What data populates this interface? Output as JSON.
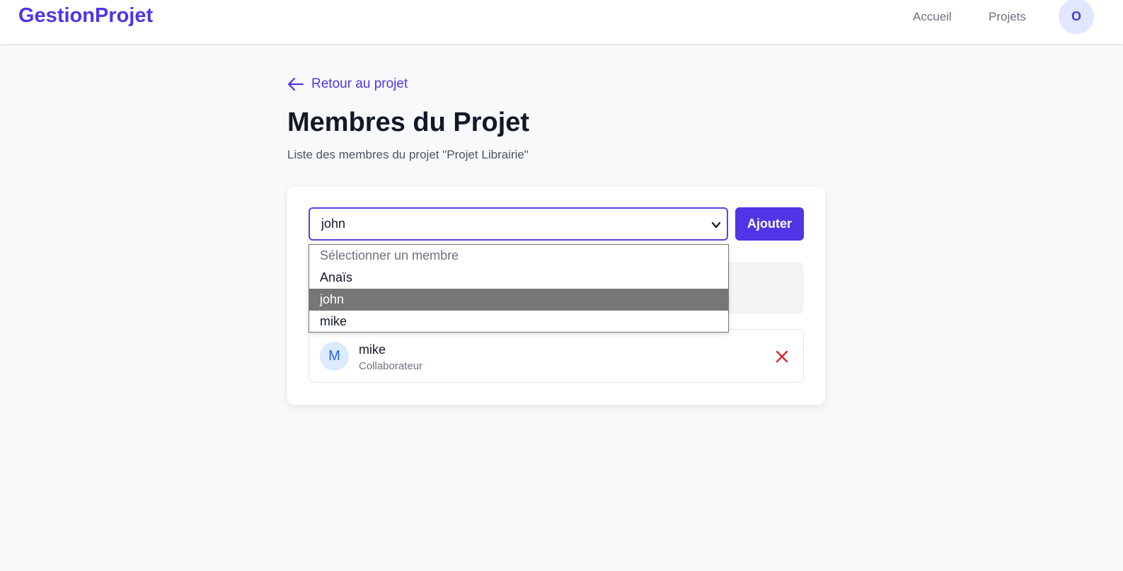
{
  "navbar": {
    "brand": "GestionProjet",
    "links": [
      {
        "label": "Accueil"
      },
      {
        "label": "Projets"
      }
    ],
    "user_initial": "O"
  },
  "back_link": {
    "label": "Retour au projet",
    "icon": "arrow-left-icon"
  },
  "page": {
    "title": "Membres du Projet",
    "subtitle": "Liste des membres du projet \"Projet Librairie\""
  },
  "add_member": {
    "selected_value": "john",
    "button_label": "Ajouter",
    "options": [
      {
        "label": "Sélectionner un membre",
        "placeholder": true
      },
      {
        "label": "Anaïs"
      },
      {
        "label": "john",
        "selected": true
      },
      {
        "label": "mike"
      }
    ]
  },
  "members": [
    {
      "initial": "M",
      "name": "mike",
      "role": "Collaborateur",
      "remove_icon": "close-icon"
    }
  ],
  "colors": {
    "accent": "#4f35e6",
    "remove": "#dc2626",
    "selected_option_bg": "#767676"
  }
}
